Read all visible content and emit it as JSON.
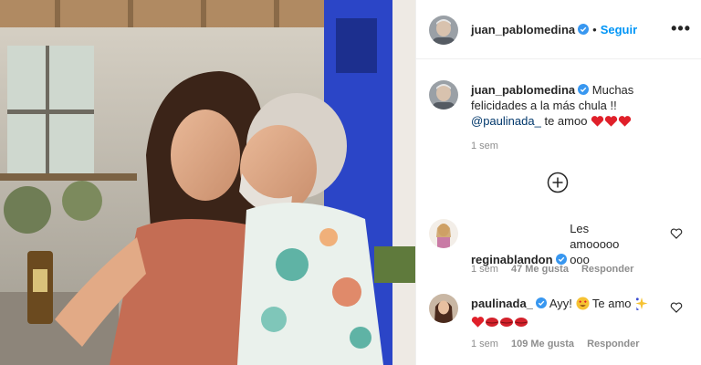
{
  "post": {
    "photo_alt": "",
    "owner": {
      "username": "juan_pablomedina",
      "verified": true,
      "follow_label": "Seguir",
      "separator": "•",
      "more_label": "•••"
    }
  },
  "caption": {
    "username": "juan_pablomedina",
    "text": "Muchas felicidades a la más chula !!",
    "mention": "@paulinada_",
    "after_mention": "te amoo",
    "emojis": [
      "red-heart",
      "red-heart",
      "red-heart"
    ],
    "time": "1 sem"
  },
  "load_more": {
    "icon": "plus-circle-icon"
  },
  "comments": [
    {
      "username": "reginablandon",
      "verified": true,
      "text": "Les amoooooooo",
      "time": "1 sem",
      "likes": "47 Me gusta",
      "reply": "Responder"
    },
    {
      "username": "paulinada_",
      "verified": true,
      "text_before": "Ayy!",
      "text_after": "Te amo",
      "emojis_inline": [
        "heart-eyes",
        "sparkles"
      ],
      "emojis_line2": [
        "heart",
        "kiss",
        "kiss",
        "kiss"
      ],
      "time": "1 sem",
      "likes": "109 Me gusta",
      "reply": "Responder"
    }
  ],
  "colors": {
    "follow": "#0095f6",
    "mention": "#00376b",
    "meta": "#8e8e8e",
    "verified": "#3897f0",
    "heart": "#ed4956"
  }
}
